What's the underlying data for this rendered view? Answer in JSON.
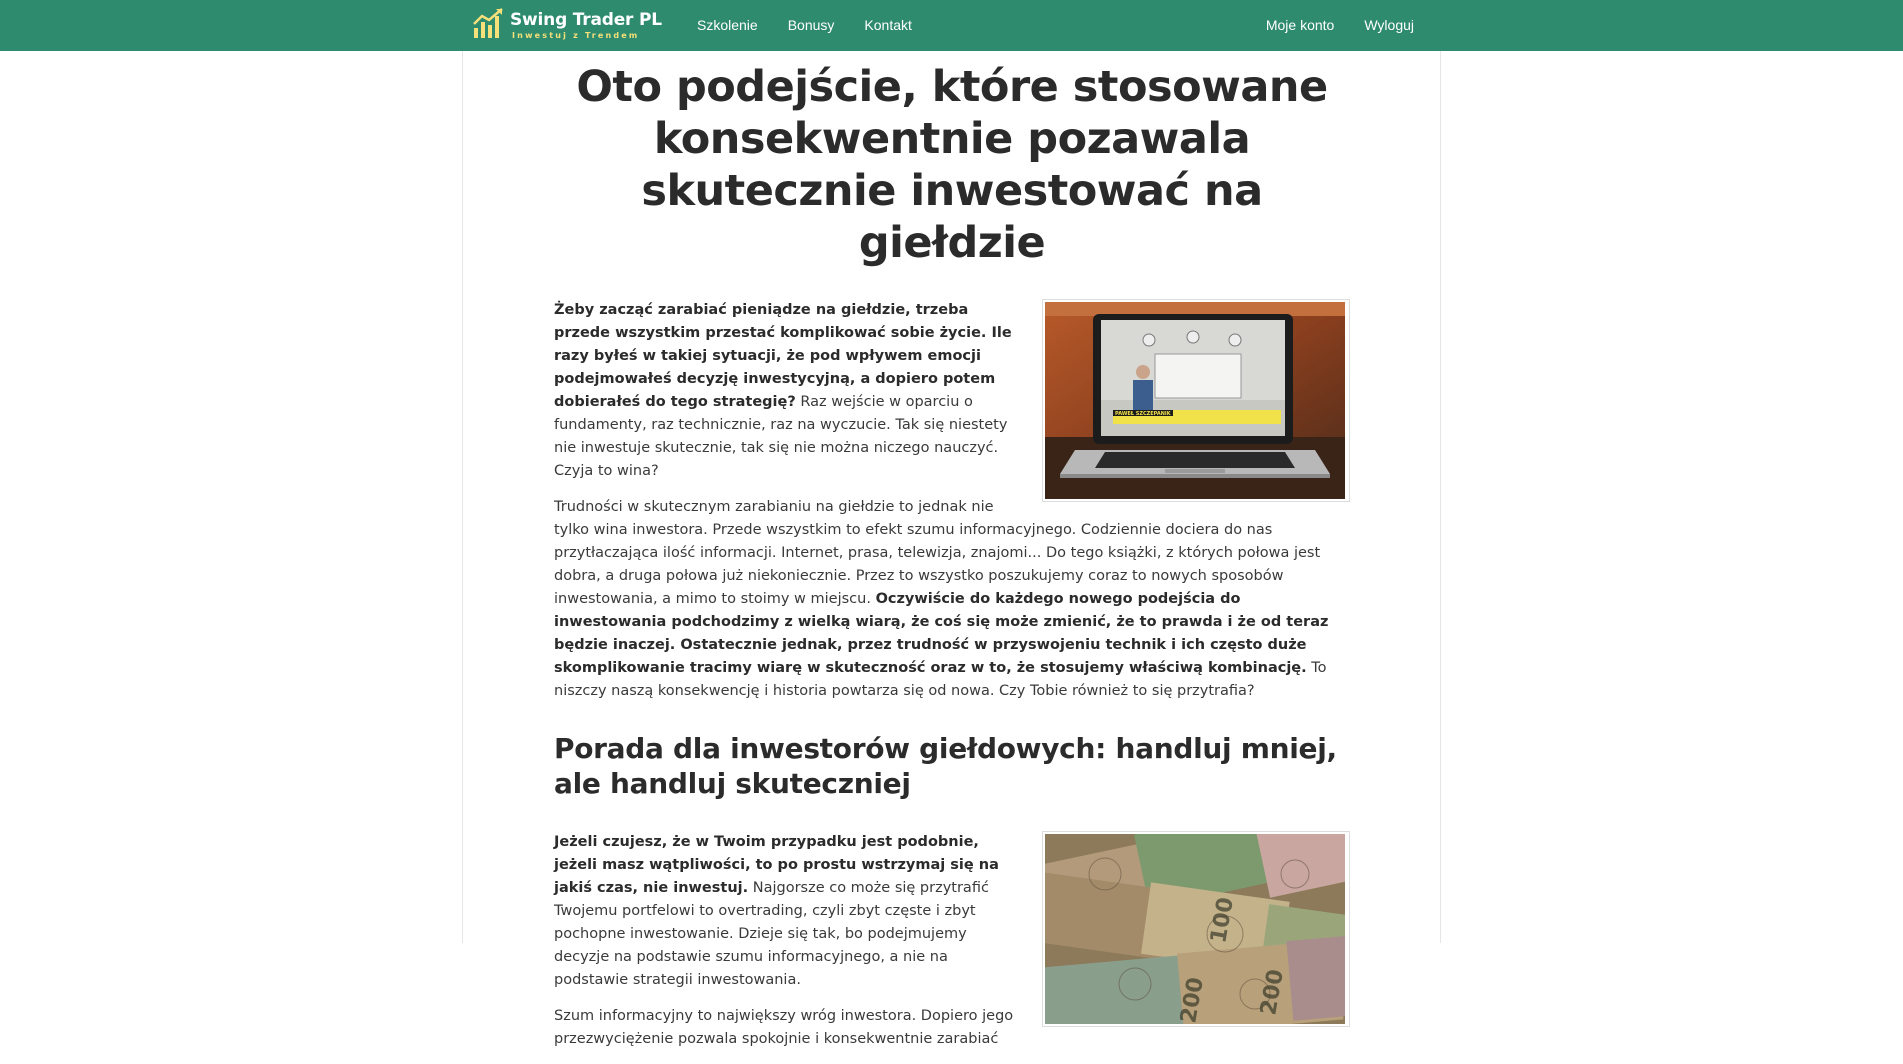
{
  "nav": {
    "logo_title": "Swing Trader PL",
    "logo_subtitle": "Inwestuj z Trendem",
    "links": [
      "Szkolenie",
      "Bonusy",
      "Kontakt"
    ],
    "account": "Moje konto",
    "logout": "Wyloguj"
  },
  "main": {
    "headline": "Oto podejście, które stosowane konsekwentnie pozawala skutecznie inwestować na giełdzie",
    "image1_caption_name": "PAWEŁ SZCZEPANIK",
    "p1_bold": "Żeby zacząć zarabiać pieniądze na giełdzie, trzeba przede wszystkim przestać komplikować sobie życie. Ile razy byłeś w takiej sytuacji, że pod wpływem emocji podejmowałeś decyzję inwestycyjną, a dopiero potem dobierałeś do tego strategię?",
    "p1_rest": " Raz wejście w oparciu o fundamenty, raz technicznie, raz na wyczucie. Tak się niestety nie inwestuje skutecznie, tak się nie można niczego nauczyć. Czyja to wina?",
    "p2_start": "Trudności w skutecznym zarabianiu na giełdzie to jednak nie tylko wina inwestora. Przede wszystkim to efekt szumu informacyjnego. Codziennie dociera do nas przytłaczająca ilość informacji. Internet, prasa, telewizja, znajomi... Do tego książki, z których połowa jest dobra, a druga połowa już niekoniecznie. Przez to wszystko poszukujemy coraz to nowych sposobów inwestowania, a mimo to stoimy w miejscu. ",
    "p2_bold": "Oczywiście do każdego nowego podejścia do inwestowania podchodzimy z wielką wiarą, że coś się może zmienić, że to prawda i że od teraz będzie inaczej. Ostatecznie jednak, przez trudność w przyswojeniu technik i ich często duże skomplikowanie tracimy wiarę w skuteczność oraz w to, że stosujemy właściwą kombinację.",
    "p2_end": " To niszczy naszą konsekwencję i historia powtarza się od nowa. Czy Tobie również to się przytrafia?",
    "subheading": "Porada dla inwestorów giełdowych: handluj mniej, ale handluj skuteczniej",
    "p3_bold": "Jeżeli czujesz, że w Twoim przypadku jest podobnie, jeżeli masz wątpliwości, to po prostu wstrzymaj się na jakiś czas, nie inwestuj.",
    "p3_rest": " Najgorsze co może się przytrafić Twojemu portfelowi to overtrading, czyli zbyt częste i zbyt pochopne inwestowanie. Dzieje się tak, bo podejmujemy decyzje na podstawie szumu informacyjnego, a nie na podstawie strategii inwestowania.",
    "p4": "Szum informacyjny to największy wróg inwestora. Dopiero jego przezwyciężenie pozwala spokojnie i konsekwentnie zarabiać"
  },
  "colors": {
    "nav_bg": "#2e8b6e",
    "logo_accent": "#f5e07a"
  },
  "icons": {
    "logo": "chart-bars-icon"
  }
}
